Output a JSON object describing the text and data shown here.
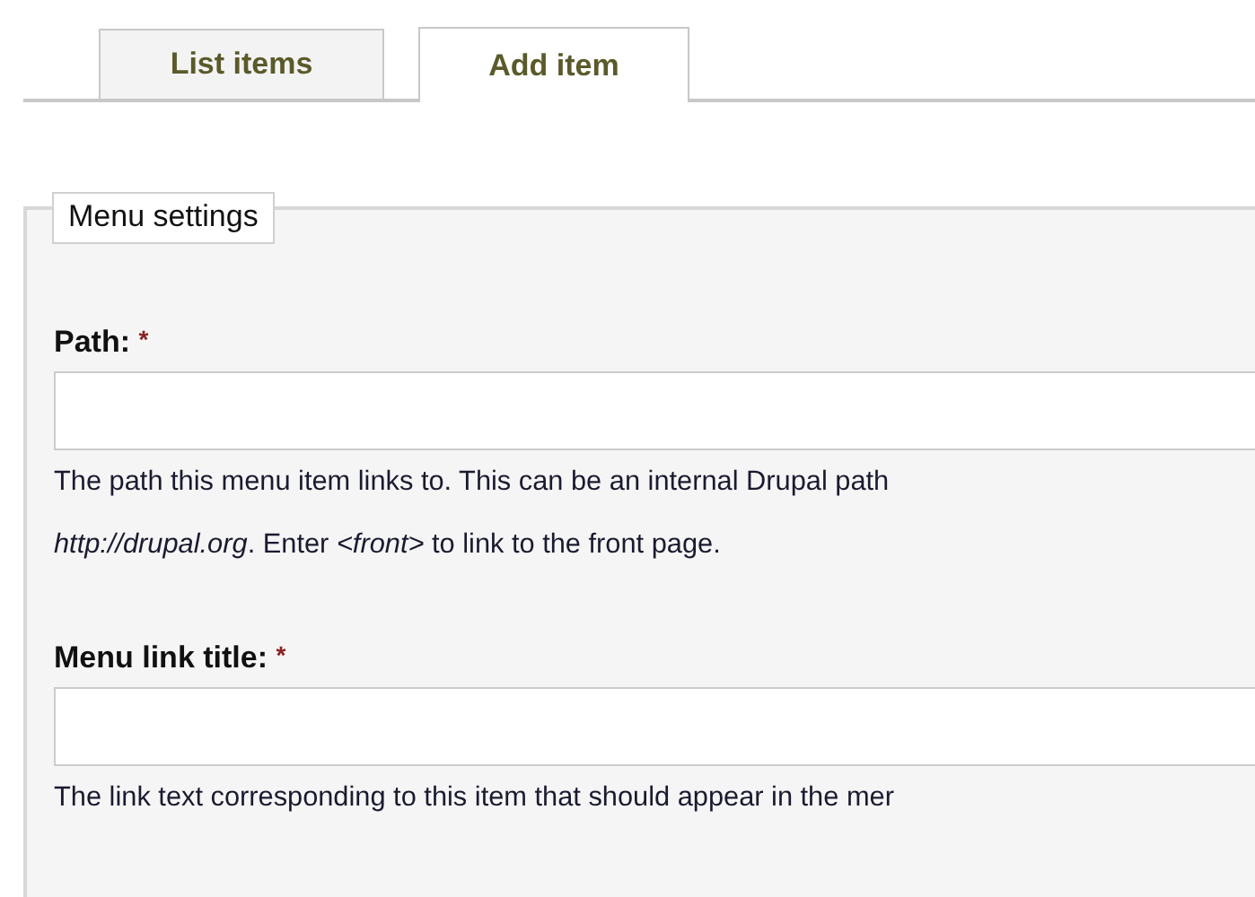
{
  "tabs": [
    {
      "label": "List items",
      "selected": false
    },
    {
      "label": "Add item",
      "selected": true
    }
  ],
  "fieldset": {
    "legend": "Menu settings",
    "fields": [
      {
        "label": "Path:",
        "required": true,
        "required_mark": "*",
        "description": [
          "The path this menu item links to. This can be an internal Drupal path",
          "*http://drupal.org*. Enter *<front>* to link to the front page."
        ]
      },
      {
        "label": "Menu link title:",
        "required": true,
        "required_mark": "*",
        "description": [
          "The link text corresponding to this item that should appear in the mer"
        ]
      }
    ]
  }
}
